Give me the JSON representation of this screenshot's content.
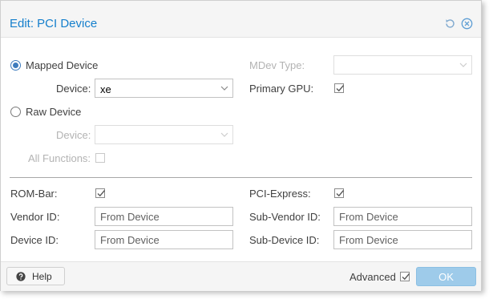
{
  "dialog": {
    "title": "Edit: PCI Device",
    "tools": [
      "reset-icon",
      "close-icon"
    ]
  },
  "source": {
    "mapped_label": "Mapped Device",
    "mapped_selected": true,
    "raw_label": "Raw Device",
    "raw_selected": false
  },
  "left": {
    "device_label": "Device:",
    "device_value": "xe",
    "raw_device_label": "Device:",
    "raw_device_value": "",
    "all_functions_label": "All Functions:",
    "all_functions_checked": false
  },
  "right": {
    "mdev_type_label": "MDev Type:",
    "mdev_type_value": "",
    "primary_gpu_label": "Primary GPU:",
    "primary_gpu_checked": true
  },
  "advanced_fields": {
    "rom_bar_label": "ROM-Bar:",
    "rom_bar_checked": true,
    "pci_express_label": "PCI-Express:",
    "pci_express_checked": true,
    "vendor_id_label": "Vendor ID:",
    "vendor_id_placeholder": "From Device",
    "sub_vendor_id_label": "Sub-Vendor ID:",
    "sub_vendor_id_placeholder": "From Device",
    "device_id_label": "Device ID:",
    "device_id_placeholder": "From Device",
    "sub_device_id_label": "Sub-Device ID:",
    "sub_device_id_placeholder": "From Device"
  },
  "footer": {
    "help_label": "Help",
    "help_icon": "question-circle-icon",
    "advanced_label": "Advanced",
    "advanced_checked": true,
    "ok_label": "OK"
  },
  "colors": {
    "accent": "#157fcc",
    "ok_button": "#9ecbea",
    "panel_bg": "#f5f5f5"
  }
}
